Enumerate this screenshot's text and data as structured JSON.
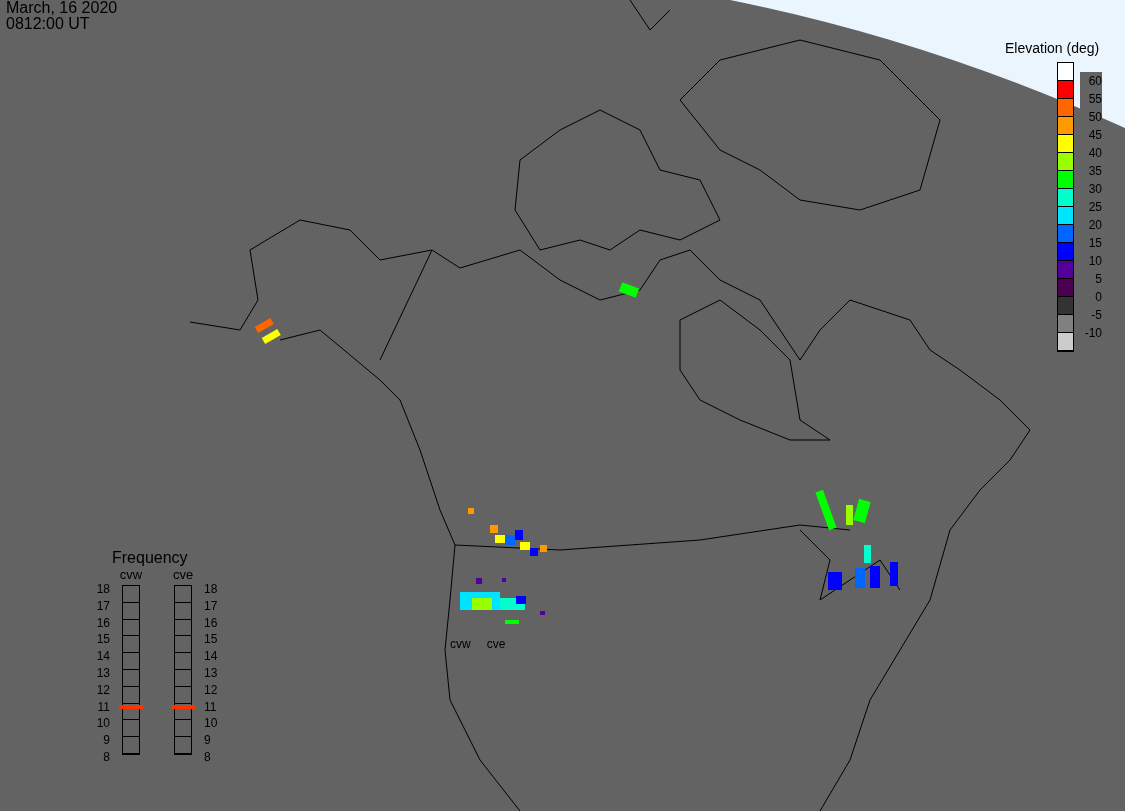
{
  "header": {
    "date": "March, 16 2020",
    "time": "0812:00 UT"
  },
  "radar_labels": [
    "cvw",
    "cve"
  ],
  "elevation_legend": {
    "title": "Elevation (deg)",
    "segments": [
      {
        "color": "#ffffff"
      },
      {
        "color": "#ff0000"
      },
      {
        "color": "#ff6600"
      },
      {
        "color": "#ff9900"
      },
      {
        "color": "#ffff00"
      },
      {
        "color": "#99ff00"
      },
      {
        "color": "#00ff00"
      },
      {
        "color": "#00ffcc"
      },
      {
        "color": "#00e5ff"
      },
      {
        "color": "#0066ff"
      },
      {
        "color": "#0000ff"
      },
      {
        "color": "#520099"
      },
      {
        "color": "#4d0050"
      },
      {
        "color": "#333333"
      },
      {
        "color": "#808080"
      },
      {
        "color": "#cccccc"
      }
    ],
    "labels": [
      "60",
      "55",
      "50",
      "45",
      "40",
      "35",
      "30",
      "25",
      "20",
      "15",
      "10",
      "5",
      "0",
      "-5",
      "-10"
    ]
  },
  "frequency": {
    "title": "Frequency",
    "left_ticks": [
      "18",
      "17",
      "16",
      "15",
      "14",
      "13",
      "12",
      "11",
      "10",
      "9",
      "8"
    ],
    "right_ticks": [
      "18",
      "17",
      "16",
      "15",
      "14",
      "13",
      "12",
      "11",
      "10",
      "9",
      "8"
    ],
    "meters": [
      {
        "label": "cvw",
        "level": 0.28
      },
      {
        "label": "cve",
        "level": 0.28
      }
    ]
  }
}
